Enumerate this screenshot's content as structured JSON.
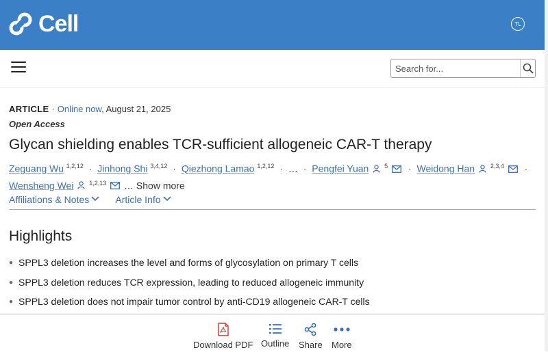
{
  "brand": {
    "name": "Cell",
    "user_badge": "TL"
  },
  "search": {
    "placeholder": "Search for..."
  },
  "article": {
    "type": "ARTICLE",
    "online_label": "Online now",
    "date": ", August 21, 2025",
    "access": "Open Access",
    "title": "Glycan shielding enables TCR-sufficient allogeneic CAR-T therapy",
    "authors": [
      {
        "name": "Zeguang Wu",
        "sup": "1,2,12"
      },
      {
        "name": "Jinhong Shi",
        "sup": "3,4,12"
      },
      {
        "name": "Qiezhong Lamao",
        "sup": "1,2,12"
      },
      {
        "name": "Pengfei Yuan",
        "sup": "5"
      },
      {
        "name": "Weidong Han",
        "sup": "2,3,4"
      },
      {
        "name": "Wensheng Wei",
        "sup": "1,2,13"
      }
    ],
    "ellipsis": "…",
    "show_more": "… Show more",
    "affiliations_label": "Affiliations & Notes",
    "article_info_label": "Article Info"
  },
  "highlights": {
    "heading": "Highlights",
    "items": [
      "SPPL3 deletion increases the level and forms of glycosylation on primary T cells",
      "SPPL3 deletion reduces TCR expression, leading to reduced allogeneic immunity",
      "SPPL3 deletion does not impair tumor control by anti-CD19 allogeneic CAR-T cells"
    ]
  },
  "bottom_bar": {
    "download_pdf": "Download PDF",
    "outline": "Outline",
    "share": "Share",
    "more": "More"
  },
  "colors": {
    "brand_blue": "#3b80c6",
    "link_blue": "#3b6fb6",
    "pdf_red": "#d9342b"
  }
}
